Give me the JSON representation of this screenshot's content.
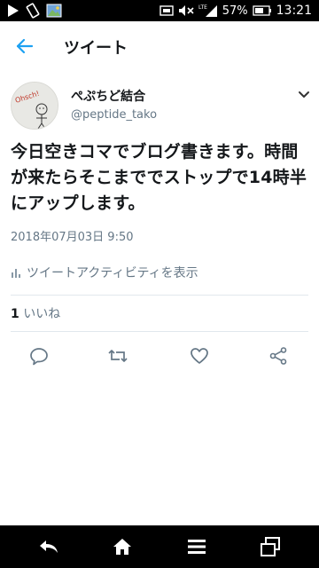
{
  "status_bar": {
    "battery": "57%",
    "time": "13:21",
    "network": "LTE",
    "icons": [
      "play-icon",
      "rotate-icon",
      "gallery-icon",
      "data-saver-icon",
      "mute-icon",
      "signal-icon",
      "battery-icon"
    ]
  },
  "header": {
    "title": "ツイート",
    "back_icon": "arrow-left-icon"
  },
  "tweet": {
    "author_name": "ぺぷちど結合",
    "author_handle": "@peptide_tako",
    "avatar_text": "Ohsch!",
    "text": "今日空きコマでブログ書きます。時間が来たらそこまででストップで14時半にアップします。",
    "timestamp": "2018年07月03日 9:50",
    "activity_label": "ツイートアクティビティを表示",
    "likes_count": "1",
    "likes_label": "いいね"
  },
  "actions": [
    "reply-icon",
    "retweet-icon",
    "like-icon",
    "share-icon"
  ],
  "nav_bar": [
    "back-icon",
    "home-icon",
    "menu-icon",
    "recent-apps-icon"
  ],
  "colors": {
    "accent": "#1da1f2",
    "text": "#14171a",
    "secondary": "#657786",
    "divider": "#e1e8ed",
    "system_bar": "#000000"
  }
}
